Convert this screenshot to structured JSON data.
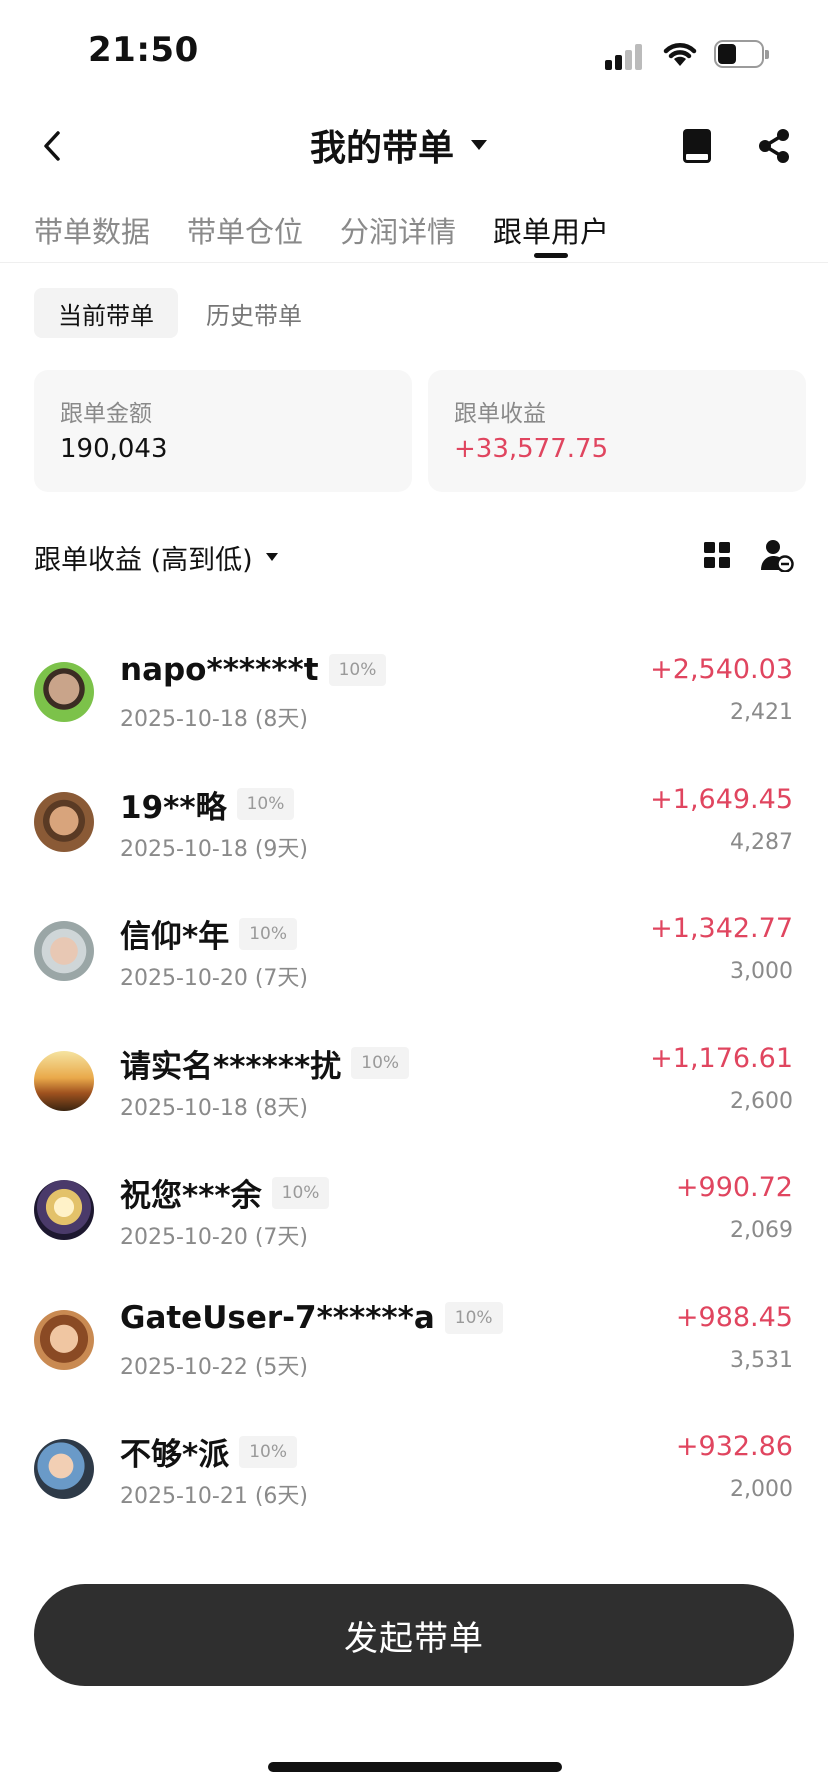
{
  "status_bar": {
    "time": "21:50"
  },
  "header": {
    "title": "我的带单",
    "back_icon": "chevron-left-icon",
    "book_icon": "book-icon",
    "share_icon": "share-icon"
  },
  "tabs": [
    {
      "label": "带单数据",
      "active": false
    },
    {
      "label": "带单仓位",
      "active": false
    },
    {
      "label": "分润详情",
      "active": false
    },
    {
      "label": "跟单用户",
      "active": true
    }
  ],
  "sub_tabs": {
    "current": "当前带单",
    "history": "历史带单"
  },
  "summary": {
    "amount_label": "跟单金额",
    "amount_value": "190,043",
    "profit_label": "跟单收益",
    "profit_value": "+33,577.75"
  },
  "sort": {
    "label": "跟单收益 (高到低)"
  },
  "users": [
    {
      "name": "napo******t",
      "share": "10%",
      "date": "2025-10-18 (8天)",
      "profit": "+2,540.03",
      "amount": "2,421"
    },
    {
      "name": "19**略",
      "share": "10%",
      "date": "2025-10-18 (9天)",
      "profit": "+1,649.45",
      "amount": "4,287"
    },
    {
      "name": "信仰*年",
      "share": "10%",
      "date": "2025-10-20 (7天)",
      "profit": "+1,342.77",
      "amount": "3,000"
    },
    {
      "name": "请实名******扰",
      "share": "10%",
      "date": "2025-10-18 (8天)",
      "profit": "+1,176.61",
      "amount": "2,600"
    },
    {
      "name": "祝您***余",
      "share": "10%",
      "date": "2025-10-20 (7天)",
      "profit": "+990.72",
      "amount": "2,069"
    },
    {
      "name": "GateUser-7******a",
      "share": "10%",
      "date": "2025-10-22 (5天)",
      "profit": "+988.45",
      "amount": "3,531"
    },
    {
      "name": "不够*派",
      "share": "10%",
      "date": "2025-10-21 (6天)",
      "profit": "+932.86",
      "amount": "2,000"
    }
  ],
  "colors": {
    "positive": "#e0455f",
    "button_bg": "#2f2f2f"
  },
  "bottom": {
    "launch_label": "发起带单"
  }
}
